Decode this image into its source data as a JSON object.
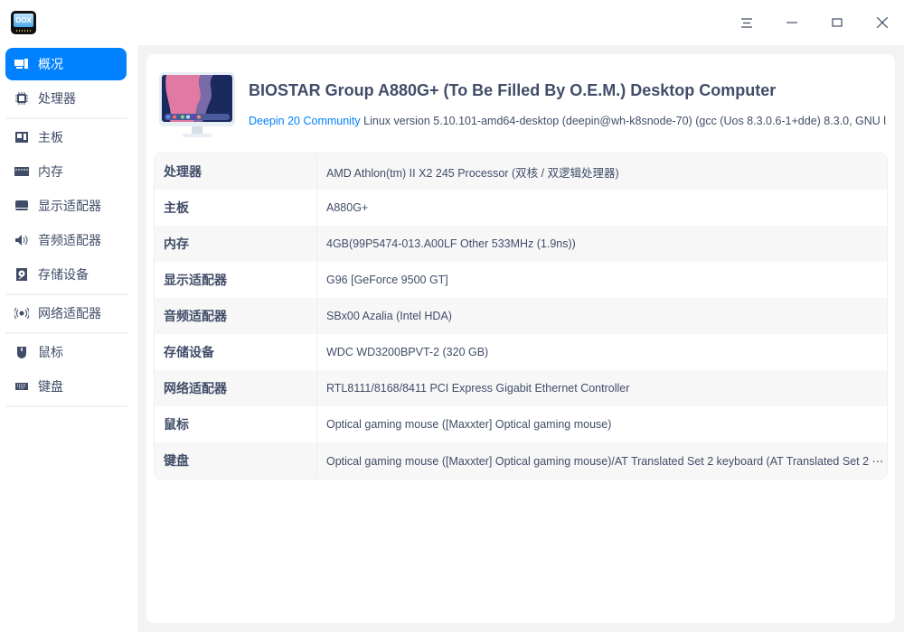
{
  "window": {
    "app_icon_text": "OOX"
  },
  "sidebar": {
    "items": [
      {
        "label": "概况",
        "icon": "overview-icon"
      },
      {
        "label": "处理器",
        "icon": "cpu-icon"
      },
      {
        "label": "主板",
        "icon": "motherboard-icon"
      },
      {
        "label": "内存",
        "icon": "memory-icon"
      },
      {
        "label": "显示适配器",
        "icon": "display-icon"
      },
      {
        "label": "音频适配器",
        "icon": "audio-icon"
      },
      {
        "label": "存储设备",
        "icon": "storage-icon"
      },
      {
        "label": "网络适配器",
        "icon": "network-icon"
      },
      {
        "label": "鼠标",
        "icon": "mouse-icon"
      },
      {
        "label": "键盘",
        "icon": "keyboard-icon"
      }
    ]
  },
  "header": {
    "title": "BIOSTAR Group A880G+ (To Be Filled By O.E.M.) Desktop Computer",
    "os_link": "Deepin 20 Community",
    "kernel": " Linux version 5.10.101-amd64-desktop (deepin@wh-k8snode-70) (gcc (Uos 8.3.0.6-1+dde) 8.3.0, GNU l…"
  },
  "table": [
    {
      "key": "处理器",
      "value": "AMD Athlon(tm) II X2 245 Processor (双核 / 双逻辑处理器)"
    },
    {
      "key": "主板",
      "value": "A880G+"
    },
    {
      "key": "内存",
      "value": "4GB(99P5474-013.A00LF Other 533MHz (1.9ns))"
    },
    {
      "key": "显示适配器",
      "value": "G96 [GeForce 9500 GT]"
    },
    {
      "key": "音频适配器",
      "value": "SBx00 Azalia (Intel HDA)"
    },
    {
      "key": "存储设备",
      "value": "WDC WD3200BPVT-2 (320 GB)"
    },
    {
      "key": "网络适配器",
      "value": "RTL8111/8168/8411 PCI Express Gigabit Ethernet Controller"
    },
    {
      "key": "鼠标",
      "value": "Optical gaming mouse ([Maxxter] Optical gaming mouse)"
    },
    {
      "key": "键盘",
      "value": "Optical gaming mouse ([Maxxter] Optical gaming mouse)/AT Translated Set 2 keyboard (AT Translated Set 2 ⋯"
    }
  ],
  "colors": {
    "accent": "#0081ff",
    "text": "#414d68"
  }
}
